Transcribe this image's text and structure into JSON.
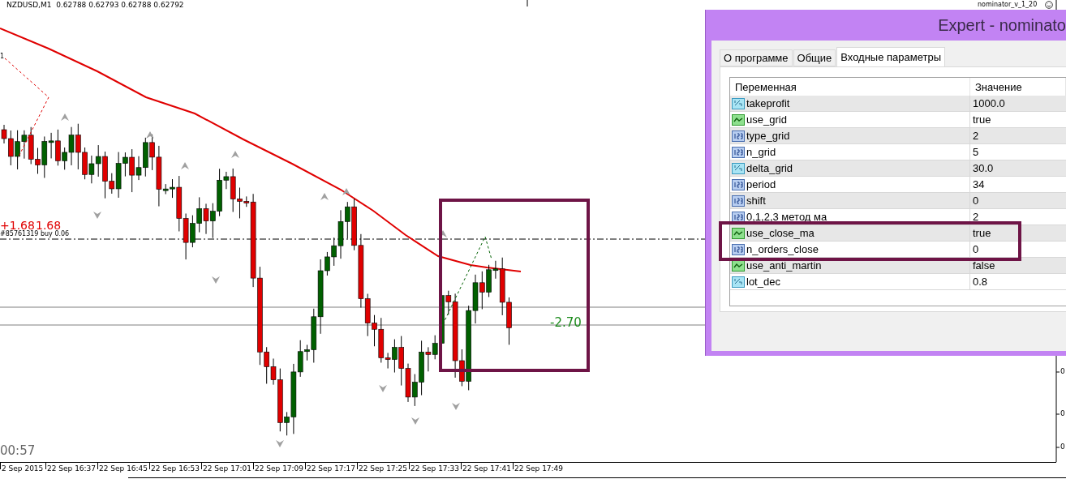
{
  "chart": {
    "symbol_info": "NZDUSD,M1  0.62788 0.62793 0.62788 0.62792",
    "expert_label": "nominator_v_1_20",
    "corner_label": "1",
    "profit_labels": [
      "+1.68",
      "1.68"
    ],
    "order_label": "#85761319 buy 0.06",
    "price_label": "-2.70",
    "timer": "00:57",
    "time_axis": [
      "2 Sep 2015",
      "22 Sep 16:37",
      "22 Sep 16:45",
      "22 Sep 16:53",
      "22 Sep 17:01",
      "22 Sep 17:09",
      "22 Sep 17:17",
      "22 Sep 17:25",
      "22 Sep 17:33",
      "22 Sep 17:41",
      "22 Sep 17:49"
    ],
    "price_axis": [
      "0",
      "0",
      "0"
    ]
  },
  "dialog": {
    "title": "Expert - nominato",
    "tabs": [
      {
        "label": "О программе",
        "selected": false
      },
      {
        "label": "Общие",
        "selected": false
      },
      {
        "label": "Входные параметры",
        "selected": true
      }
    ],
    "table": {
      "columns": [
        "Переменная",
        "Значение"
      ],
      "rows": [
        {
          "kind": "double",
          "name": "takeprofit",
          "value": "1000.0"
        },
        {
          "kind": "bool",
          "name": "use_grid",
          "value": "true"
        },
        {
          "kind": "int",
          "name": "type_grid",
          "value": "2"
        },
        {
          "kind": "int",
          "name": "n_grid",
          "value": "5"
        },
        {
          "kind": "double",
          "name": "delta_grid",
          "value": "30.0"
        },
        {
          "kind": "int",
          "name": "period",
          "value": "34"
        },
        {
          "kind": "int",
          "name": "shift",
          "value": "0"
        },
        {
          "kind": "int",
          "name": "0,1,2,3 метод ма",
          "value": "2"
        },
        {
          "kind": "bool",
          "name": "use_close_ma",
          "value": "true"
        },
        {
          "kind": "int",
          "name": "n_orders_close",
          "value": "0"
        },
        {
          "kind": "bool",
          "name": "use_anti_martin",
          "value": "false"
        },
        {
          "kind": "double",
          "name": "lot_dec",
          "value": "0.8"
        }
      ]
    }
  }
}
